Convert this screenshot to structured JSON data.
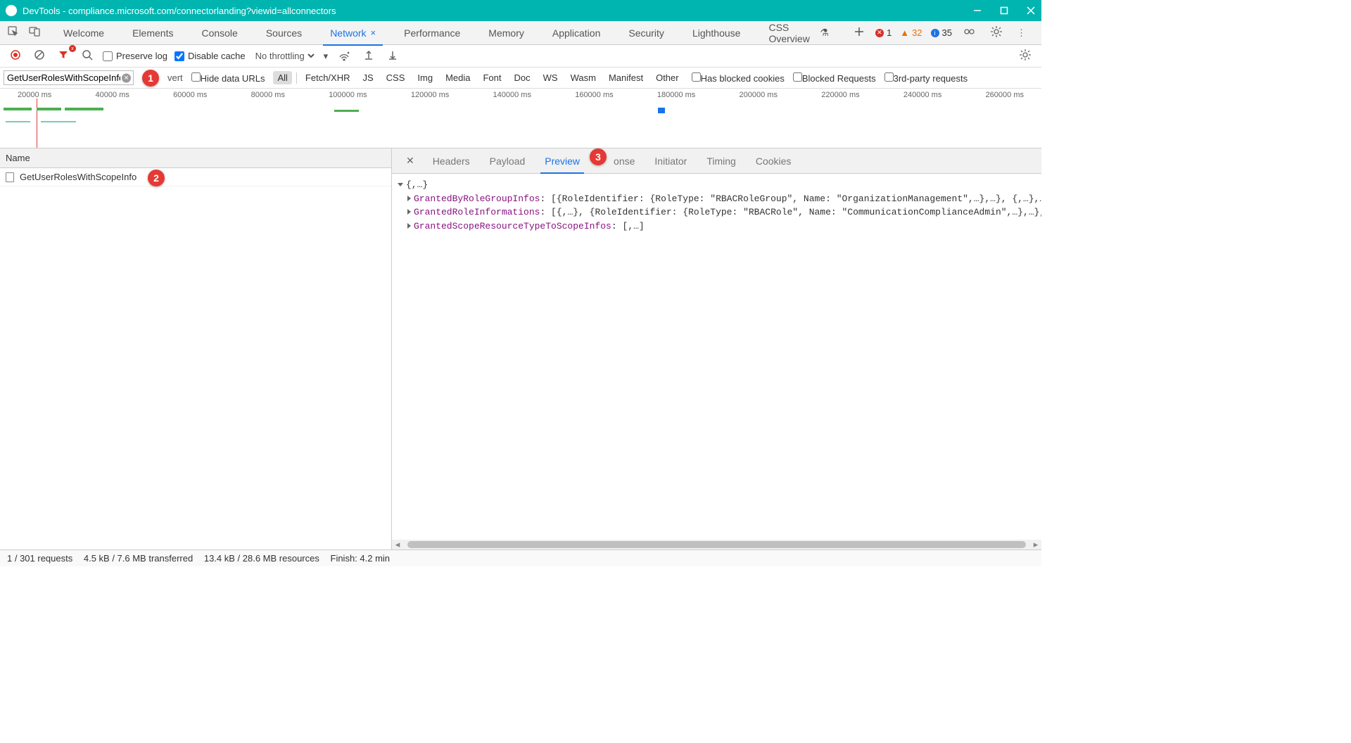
{
  "title": "DevTools - compliance.microsoft.com/connectorlanding?viewid=allconnectors",
  "main_tabs": {
    "items": [
      "Welcome",
      "Elements",
      "Console",
      "Sources",
      "Network",
      "Performance",
      "Memory",
      "Application",
      "Security",
      "Lighthouse",
      "CSS Overview"
    ],
    "active_index": 4
  },
  "badges": {
    "errors": "1",
    "warnings": "32",
    "info": "35"
  },
  "toolbar": {
    "preserve_log_label": "Preserve log",
    "preserve_log_checked": false,
    "disable_cache_label": "Disable cache",
    "disable_cache_checked": true,
    "throttling": "No throttling"
  },
  "filter": {
    "input_value": "GetUserRolesWithScopeInfo",
    "invert_frag": "vert",
    "hide_urls_label": "Hide data URLs",
    "types": [
      "All",
      "Fetch/XHR",
      "JS",
      "CSS",
      "Img",
      "Media",
      "Font",
      "Doc",
      "WS",
      "Wasm",
      "Manifest",
      "Other"
    ],
    "active_type_index": 0,
    "has_blocked_cookies": "Has blocked cookies",
    "blocked_requests": "Blocked Requests",
    "third_party": "3rd-party requests"
  },
  "timeline_ticks": [
    "20000 ms",
    "40000 ms",
    "60000 ms",
    "80000 ms",
    "100000 ms",
    "120000 ms",
    "140000 ms",
    "160000 ms",
    "180000 ms",
    "200000 ms",
    "220000 ms",
    "240000 ms",
    "260000 ms"
  ],
  "requests": {
    "header": "Name",
    "items": [
      "GetUserRolesWithScopeInfo"
    ]
  },
  "detail_tabs": {
    "items": [
      "Headers",
      "Payload",
      "Preview",
      "Response",
      "Initiator",
      "Timing",
      "Cookies"
    ],
    "active_index": 2,
    "response_frag": "onse"
  },
  "preview": {
    "root": "{,…}",
    "line1_key": "GrantedByRoleGroupInfos",
    "line1_rest": ": [{RoleIdentifier: {RoleType: \"RBACRoleGroup\", Name: \"OrganizationManagement\",…},…}, {,…},…",
    "line2_key": "GrantedRoleInformations",
    "line2_rest": ": [{,…}, {RoleIdentifier: {RoleType: \"RBACRole\", Name: \"CommunicationComplianceAdmin\",…},…},…",
    "line3_key": "GrantedScopeResourceTypeToScopeInfos",
    "line3_rest": ": [,…]"
  },
  "status": {
    "requests": "1 / 301 requests",
    "transferred": "4.5 kB / 7.6 MB transferred",
    "resources": "13.4 kB / 28.6 MB resources",
    "finish": "Finish: 4.2 min"
  },
  "callouts": {
    "one": "1",
    "two": "2",
    "three": "3"
  }
}
